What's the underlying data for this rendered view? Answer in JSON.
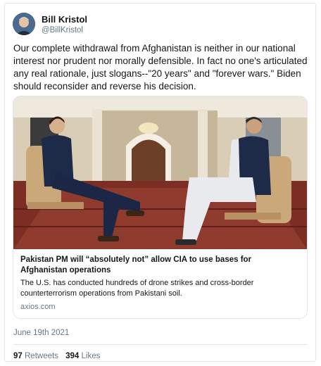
{
  "tweet": {
    "author_name": "Bill Kristol",
    "author_handle": "@BillKristol",
    "text": "Our complete withdrawal from Afghanistan is neither in our national interest nor prudent nor morally defensible. In fact no one's articulated any real rationale, just slogans--\"20 years\" and \"forever wars.\" Biden should reconsider and reverse his decision.",
    "date": "June 19th 2021",
    "retweets_count": "97",
    "retweets_label": "Retweets",
    "likes_count": "394",
    "likes_label": "Likes"
  },
  "card": {
    "title": "Pakistan PM will “absolutely not” allow CIA to use bases for Afghanistan operations",
    "description": "The U.S. has conducted hundreds of drone strikes and cross-border counterterrorism operations from Pakistani soil.",
    "domain": "axios.com"
  }
}
